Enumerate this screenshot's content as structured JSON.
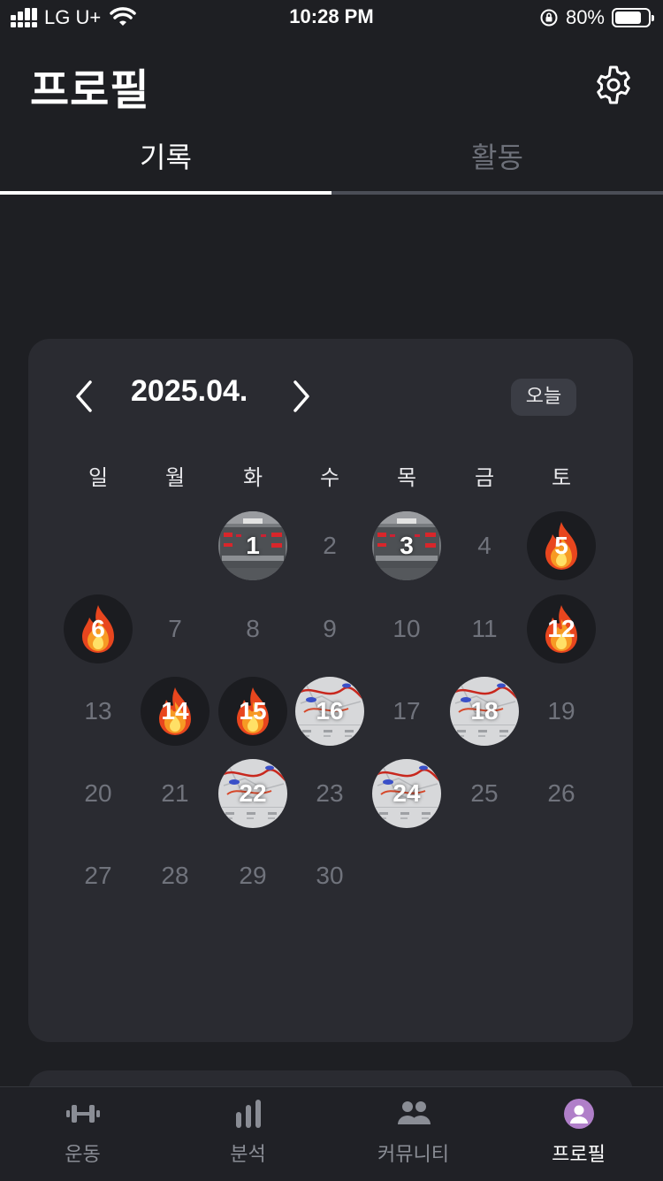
{
  "status_bar": {
    "carrier": "LG U+",
    "time": "10:28 PM",
    "battery_percent_text": "80%",
    "battery_level": 0.8
  },
  "header": {
    "title": "프로필",
    "settings_icon": "gear-icon"
  },
  "tabs": [
    {
      "label": "기록",
      "active": true
    },
    {
      "label": "활동",
      "active": false
    }
  ],
  "calendar": {
    "month_label": "2025.04.",
    "today_button": "오늘",
    "weekdays": [
      "일",
      "월",
      "화",
      "수",
      "목",
      "금",
      "토"
    ],
    "weeks": [
      [
        null,
        null,
        {
          "d": "1",
          "type": "treadmill"
        },
        {
          "d": "2"
        },
        {
          "d": "3",
          "type": "treadmill"
        },
        {
          "d": "4"
        },
        {
          "d": "5",
          "type": "fire"
        }
      ],
      [
        {
          "d": "6",
          "type": "fire"
        },
        {
          "d": "7"
        },
        {
          "d": "8"
        },
        {
          "d": "9"
        },
        {
          "d": "10"
        },
        {
          "d": "11"
        },
        {
          "d": "12",
          "type": "fire"
        }
      ],
      [
        {
          "d": "13"
        },
        {
          "d": "14",
          "type": "fire"
        },
        {
          "d": "15",
          "type": "fire"
        },
        {
          "d": "16",
          "type": "map"
        },
        {
          "d": "17"
        },
        {
          "d": "18",
          "type": "map"
        },
        {
          "d": "19"
        }
      ],
      [
        {
          "d": "20"
        },
        {
          "d": "21"
        },
        {
          "d": "22",
          "type": "map"
        },
        {
          "d": "23"
        },
        {
          "d": "24",
          "type": "map"
        },
        {
          "d": "25"
        },
        {
          "d": "26"
        }
      ],
      [
        {
          "d": "27"
        },
        {
          "d": "28"
        },
        {
          "d": "29"
        },
        {
          "d": "30"
        },
        null,
        null,
        null
      ]
    ]
  },
  "bottom_nav": [
    {
      "label": "운동",
      "icon": "dumbbell-icon",
      "active": false
    },
    {
      "label": "분석",
      "icon": "bar-chart-icon",
      "active": false
    },
    {
      "label": "커뮤니티",
      "icon": "community-icon",
      "active": false
    },
    {
      "label": "프로필",
      "icon": "profile-icon",
      "active": true
    }
  ],
  "colors": {
    "background": "#1e1f23",
    "card": "#2a2b31",
    "inactive_text": "#70737c",
    "accent_profile": "#b07fc9"
  }
}
